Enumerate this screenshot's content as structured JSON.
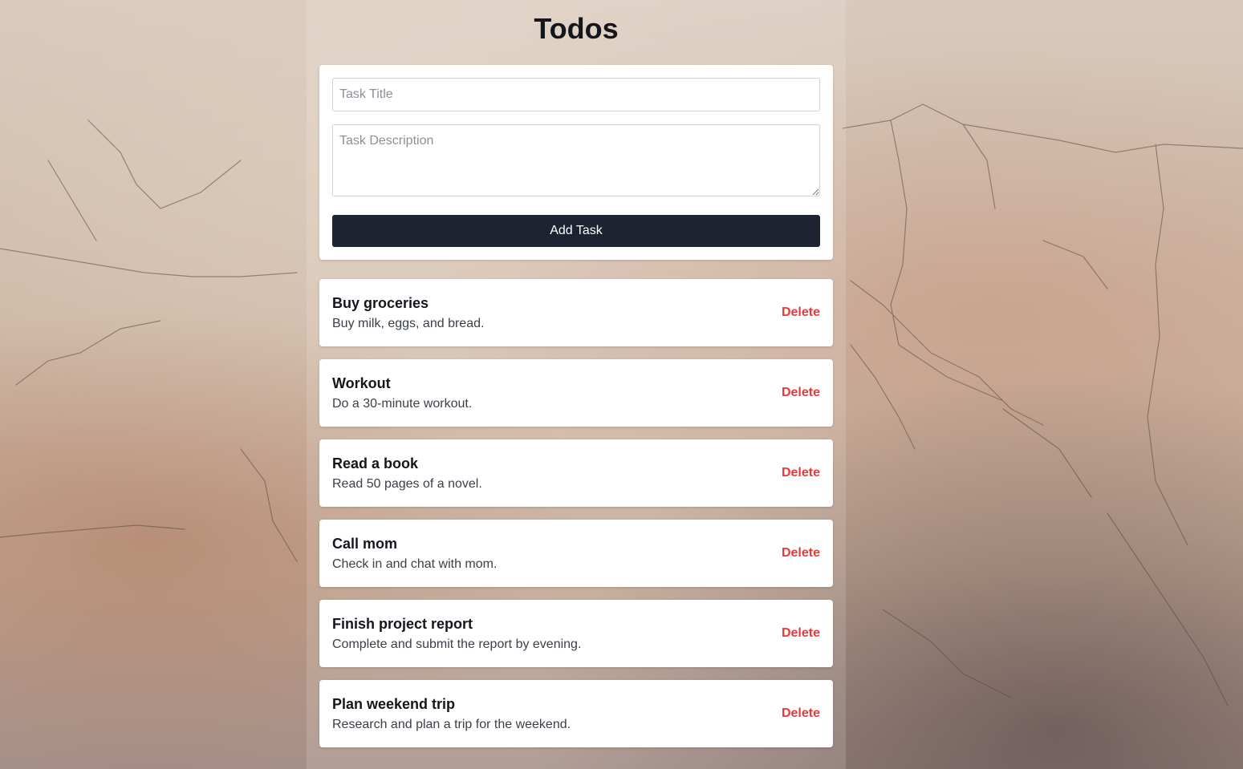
{
  "header": {
    "title": "Todos"
  },
  "form": {
    "title_placeholder": "Task Title",
    "title_value": "",
    "description_placeholder": "Task Description",
    "description_value": "",
    "add_button_label": "Add Task"
  },
  "tasks": [
    {
      "title": "Buy groceries",
      "description": "Buy milk, eggs, and bread.",
      "delete_label": "Delete"
    },
    {
      "title": "Workout",
      "description": "Do a 30-minute workout.",
      "delete_label": "Delete"
    },
    {
      "title": "Read a book",
      "description": "Read 50 pages of a novel.",
      "delete_label": "Delete"
    },
    {
      "title": "Call mom",
      "description": "Check in and chat with mom.",
      "delete_label": "Delete"
    },
    {
      "title": "Finish project report",
      "description": "Complete and submit the report by evening.",
      "delete_label": "Delete"
    },
    {
      "title": "Plan weekend trip",
      "description": "Research and plan a trip for the weekend.",
      "delete_label": "Delete"
    }
  ],
  "colors": {
    "button_bg": "#1d2330",
    "delete_text": "#e53b3b",
    "heading_text": "#14161c"
  }
}
